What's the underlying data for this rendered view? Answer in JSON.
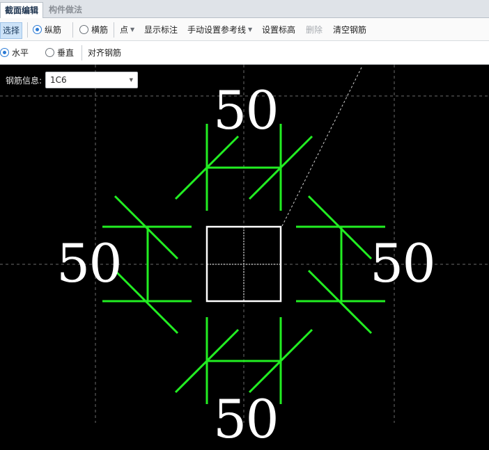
{
  "tabs": [
    {
      "label": "截面编辑",
      "active": true
    },
    {
      "label": "构件做法",
      "active": false
    }
  ],
  "toolbar": {
    "select": "选择",
    "longitudinal": "纵筋",
    "transverse": "横筋",
    "point": "点",
    "show_dims": "显示标注",
    "manual_ref": "手动设置参考线",
    "set_elev": "设置标高",
    "delete": "删除",
    "clear": "清空钢筋"
  },
  "toolbar2": {
    "horizontal": "水平",
    "vertical": "垂直",
    "align": "对齐钢筋"
  },
  "rebar_info": {
    "label": "钢筋信息:",
    "value": "1C6"
  },
  "dimensions": {
    "top": "50",
    "left": "50",
    "right": "50",
    "bottom": "50"
  },
  "colors": {
    "rebar": "#22ee22",
    "outline": "#ffffff",
    "canvas": "#000000"
  }
}
